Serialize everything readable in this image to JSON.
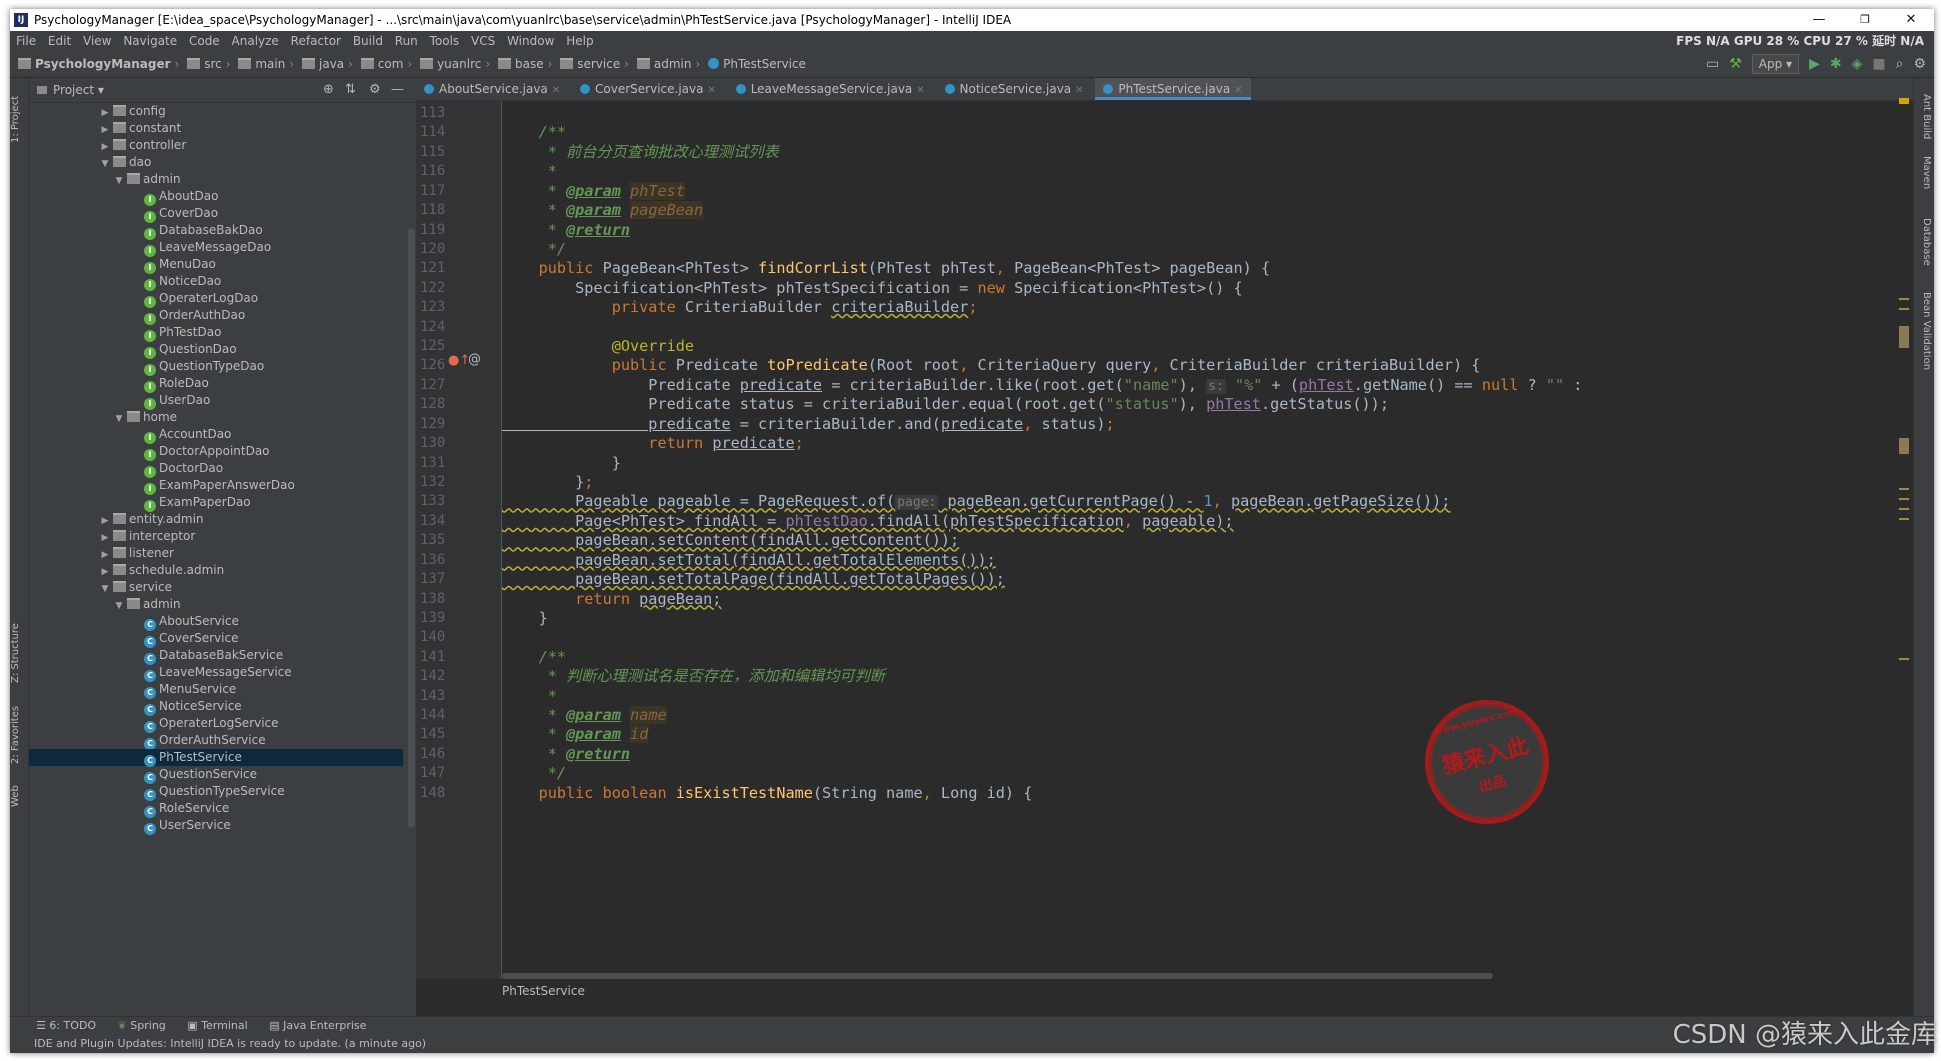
{
  "window": {
    "title": "PsychologyManager [E:\\idea_space\\PsychologyManager] - ...\\src\\main\\java\\com\\yuanlrc\\base\\service\\admin\\PhTestService.java [PsychologyManager] - IntelliJ IDEA",
    "minimize": "—",
    "restore": "❐",
    "close": "✕"
  },
  "menu": {
    "items": [
      "File",
      "Edit",
      "View",
      "Navigate",
      "Code",
      "Analyze",
      "Refactor",
      "Build",
      "Run",
      "Tools",
      "VCS",
      "Window",
      "Help"
    ],
    "stats": "FPS N/A GPU 28 % CPU 27 % 延时 N/A"
  },
  "breadcrumb": {
    "items": [
      "PsychologyManager",
      "src",
      "main",
      "java",
      "com",
      "yuanlrc",
      "base",
      "service",
      "admin",
      "PhTestService"
    ],
    "run_config": "App"
  },
  "project_panel": {
    "title": "Project",
    "tree": [
      {
        "label": "config",
        "depth": 1,
        "kind": "folder",
        "arrow": "▶"
      },
      {
        "label": "constant",
        "depth": 1,
        "kind": "folder",
        "arrow": "▶"
      },
      {
        "label": "controller",
        "depth": 1,
        "kind": "folder",
        "arrow": "▶"
      },
      {
        "label": "dao",
        "depth": 1,
        "kind": "folder",
        "arrow": "▼"
      },
      {
        "label": "admin",
        "depth": 2,
        "kind": "folder",
        "arrow": "▼"
      },
      {
        "label": "AboutDao",
        "depth": 3,
        "kind": "iface"
      },
      {
        "label": "CoverDao",
        "depth": 3,
        "kind": "iface"
      },
      {
        "label": "DatabaseBakDao",
        "depth": 3,
        "kind": "iface"
      },
      {
        "label": "LeaveMessageDao",
        "depth": 3,
        "kind": "iface"
      },
      {
        "label": "MenuDao",
        "depth": 3,
        "kind": "iface"
      },
      {
        "label": "NoticeDao",
        "depth": 3,
        "kind": "iface"
      },
      {
        "label": "OperaterLogDao",
        "depth": 3,
        "kind": "iface"
      },
      {
        "label": "OrderAuthDao",
        "depth": 3,
        "kind": "iface"
      },
      {
        "label": "PhTestDao",
        "depth": 3,
        "kind": "iface"
      },
      {
        "label": "QuestionDao",
        "depth": 3,
        "kind": "iface"
      },
      {
        "label": "QuestionTypeDao",
        "depth": 3,
        "kind": "iface"
      },
      {
        "label": "RoleDao",
        "depth": 3,
        "kind": "iface"
      },
      {
        "label": "UserDao",
        "depth": 3,
        "kind": "iface"
      },
      {
        "label": "home",
        "depth": 2,
        "kind": "folder",
        "arrow": "▼"
      },
      {
        "label": "AccountDao",
        "depth": 3,
        "kind": "iface"
      },
      {
        "label": "DoctorAppointDao",
        "depth": 3,
        "kind": "iface"
      },
      {
        "label": "DoctorDao",
        "depth": 3,
        "kind": "iface"
      },
      {
        "label": "ExamPaperAnswerDao",
        "depth": 3,
        "kind": "iface"
      },
      {
        "label": "ExamPaperDao",
        "depth": 3,
        "kind": "iface"
      },
      {
        "label": "entity.admin",
        "depth": 1,
        "kind": "folder",
        "arrow": "▶"
      },
      {
        "label": "interceptor",
        "depth": 1,
        "kind": "folder",
        "arrow": "▶"
      },
      {
        "label": "listener",
        "depth": 1,
        "kind": "folder",
        "arrow": "▶"
      },
      {
        "label": "schedule.admin",
        "depth": 1,
        "kind": "folder",
        "arrow": "▶"
      },
      {
        "label": "service",
        "depth": 1,
        "kind": "folder",
        "arrow": "▼"
      },
      {
        "label": "admin",
        "depth": 2,
        "kind": "folder",
        "arrow": "▼"
      },
      {
        "label": "AboutService",
        "depth": 3,
        "kind": "cls"
      },
      {
        "label": "CoverService",
        "depth": 3,
        "kind": "cls"
      },
      {
        "label": "DatabaseBakService",
        "depth": 3,
        "kind": "cls"
      },
      {
        "label": "LeaveMessageService",
        "depth": 3,
        "kind": "cls"
      },
      {
        "label": "MenuService",
        "depth": 3,
        "kind": "cls"
      },
      {
        "label": "NoticeService",
        "depth": 3,
        "kind": "cls"
      },
      {
        "label": "OperaterLogService",
        "depth": 3,
        "kind": "cls"
      },
      {
        "label": "OrderAuthService",
        "depth": 3,
        "kind": "cls"
      },
      {
        "label": "PhTestService",
        "depth": 3,
        "kind": "cls",
        "selected": true
      },
      {
        "label": "QuestionService",
        "depth": 3,
        "kind": "cls"
      },
      {
        "label": "QuestionTypeService",
        "depth": 3,
        "kind": "cls"
      },
      {
        "label": "RoleService",
        "depth": 3,
        "kind": "cls"
      },
      {
        "label": "UserService",
        "depth": 3,
        "kind": "cls"
      }
    ]
  },
  "editor": {
    "tabs": [
      {
        "label": "AboutService.java",
        "active": false
      },
      {
        "label": "CoverService.java",
        "active": false
      },
      {
        "label": "LeaveMessageService.java",
        "active": false
      },
      {
        "label": "NoticeService.java",
        "active": false
      },
      {
        "label": "PhTestService.java",
        "active": true
      }
    ],
    "first_line": 113,
    "lines": [
      [],
      [
        [
          "cm",
          "    /**"
        ]
      ],
      [
        [
          "cm",
          "     * 前台分页查询批改心理测试列表"
        ]
      ],
      [
        [
          "cm",
          "     *"
        ]
      ],
      [
        [
          "cm",
          "     * "
        ],
        [
          "tag",
          "@param"
        ],
        [
          "cm",
          " "
        ],
        [
          "prm",
          "phTest"
        ]
      ],
      [
        [
          "cm",
          "     * "
        ],
        [
          "tag",
          "@param"
        ],
        [
          "cm",
          " "
        ],
        [
          "prm",
          "pageBean"
        ]
      ],
      [
        [
          "cm",
          "     * "
        ],
        [
          "tag",
          "@return"
        ]
      ],
      [
        [
          "cm",
          "     */"
        ]
      ],
      [
        [
          "kw",
          "    public "
        ],
        [
          "",
          "PageBean<PhTest> "
        ],
        [
          "fn",
          "findCorrList"
        ],
        [
          "",
          "(PhTest phTest"
        ],
        [
          "kw",
          ", "
        ],
        [
          "",
          "PageBean<PhTest> pageBean) {"
        ]
      ],
      [
        [
          "",
          "        Specification<PhTest> phTestSpecification = "
        ],
        [
          "kw",
          "new "
        ],
        [
          "",
          "Specification<PhTest>() {"
        ]
      ],
      [
        [
          "kw",
          "            private "
        ],
        [
          "",
          "CriteriaBuilder "
        ],
        [
          "wav",
          "criteriaBuilder"
        ],
        [
          "kw",
          ";"
        ]
      ],
      [],
      [
        [
          "ann",
          "            @Override"
        ]
      ],
      [
        [
          "kw",
          "            public "
        ],
        [
          "",
          "Predicate "
        ],
        [
          "fn",
          "toPredicate"
        ],
        [
          "",
          "(Root root"
        ],
        [
          "kw",
          ", "
        ],
        [
          "",
          "CriteriaQuery query"
        ],
        [
          "kw",
          ", "
        ],
        [
          "",
          "CriteriaBuilder criteriaBuilder) {"
        ]
      ],
      [
        [
          "",
          "                Predicate "
        ],
        [
          "und",
          "predicate"
        ],
        [
          "",
          " = criteriaBuilder.like(root.get("
        ],
        [
          "str",
          "\"name\""
        ],
        [
          "",
          "), "
        ],
        [
          "hint",
          "s:"
        ],
        [
          "str",
          " \"%\""
        ],
        [
          "",
          " + ("
        ],
        [
          "fld und",
          "phTest"
        ],
        [
          "",
          ".getName() == "
        ],
        [
          "kw",
          "null "
        ],
        [
          "",
          "? "
        ],
        [
          "str",
          "\"\" "
        ],
        [
          "",
          ":"
        ]
      ],
      [
        [
          "",
          "                Predicate status = criteriaBuilder.equal(root.get("
        ],
        [
          "str",
          "\"status\""
        ],
        [
          "",
          "), "
        ],
        [
          "fld und",
          "phTest"
        ],
        [
          "",
          ".getStatus());"
        ]
      ],
      [
        [
          "und",
          "                predicate"
        ],
        [
          "",
          " = criteriaBuilder.and("
        ],
        [
          "und",
          "predicate"
        ],
        [
          "kw",
          ", "
        ],
        [
          "",
          "status)"
        ],
        [
          "kw",
          ";"
        ]
      ],
      [
        [
          "kw",
          "                return "
        ],
        [
          "und",
          "predicate"
        ],
        [
          "kw",
          ";"
        ]
      ],
      [
        [
          "",
          "            }"
        ]
      ],
      [
        [
          "",
          "        }"
        ],
        [
          "kw",
          ";"
        ]
      ],
      [
        [
          "wav",
          "        Pageable pageable = PageRequest."
        ],
        [
          "wav",
          "of("
        ],
        [
          "hint",
          "page:"
        ],
        [
          "wav",
          " pageBean.getCurrentPage() - "
        ],
        [
          "num",
          "1"
        ],
        [
          "kw",
          ", "
        ],
        [
          "wav",
          "pageBean.getPageSize());"
        ]
      ],
      [
        [
          "wav",
          "        Page<PhTest> findAll = "
        ],
        [
          "fld wav",
          "phTestDao"
        ],
        [
          "wav",
          ".findAll(phTestSpecification"
        ],
        [
          "kw",
          ", "
        ],
        [
          "wav",
          "pageable);"
        ]
      ],
      [
        [
          "wav",
          "        pageBean.setContent(findAll.getContent());"
        ]
      ],
      [
        [
          "wav",
          "        pageBean.setTotal(findAll.getTotalElements());"
        ]
      ],
      [
        [
          "wav",
          "        pageBean.setTotalPage(findAll.getTotalPages());"
        ]
      ],
      [
        [
          "kw",
          "        return "
        ],
        [
          "wav",
          "pageBean;"
        ]
      ],
      [
        [
          "",
          "    }"
        ]
      ],
      [],
      [
        [
          "cm",
          "    /**"
        ]
      ],
      [
        [
          "cm",
          "     * 判断心理测试名是否存在，添加和编辑均可判断"
        ]
      ],
      [
        [
          "cm",
          "     *"
        ]
      ],
      [
        [
          "cm",
          "     * "
        ],
        [
          "tag",
          "@param"
        ],
        [
          "cm",
          " "
        ],
        [
          "prm",
          "name"
        ]
      ],
      [
        [
          "cm",
          "     * "
        ],
        [
          "tag",
          "@param"
        ],
        [
          "cm",
          " "
        ],
        [
          "prm",
          "id"
        ]
      ],
      [
        [
          "cm",
          "     * "
        ],
        [
          "tag",
          "@return"
        ]
      ],
      [
        [
          "cm",
          "     */"
        ]
      ],
      [
        [
          "kw",
          "    public boolean "
        ],
        [
          "fn",
          "isExistTestName"
        ],
        [
          "",
          "(String name"
        ],
        [
          "kw",
          ", "
        ],
        [
          "",
          "Long id) {"
        ]
      ]
    ],
    "footer": "PhTestService"
  },
  "tool_windows": {
    "left": [
      "1: Project",
      "Z: Structure",
      "2: Favorites",
      "Web"
    ],
    "right": [
      "Ant Build",
      "Maven",
      "Database",
      "Bean Validation"
    ],
    "bottom": [
      "6: TODO",
      "Spring",
      "Terminal",
      "Java Enterprise"
    ]
  },
  "status": "IDE and Plugin Updates: IntelliJ IDEA is ready to update. (a minute ago)",
  "stamp": {
    "top": "www.yuanrc.com",
    "main": "猿来入此",
    "sub": "出品"
  },
  "watermark": "CSDN @猿来入此金库"
}
